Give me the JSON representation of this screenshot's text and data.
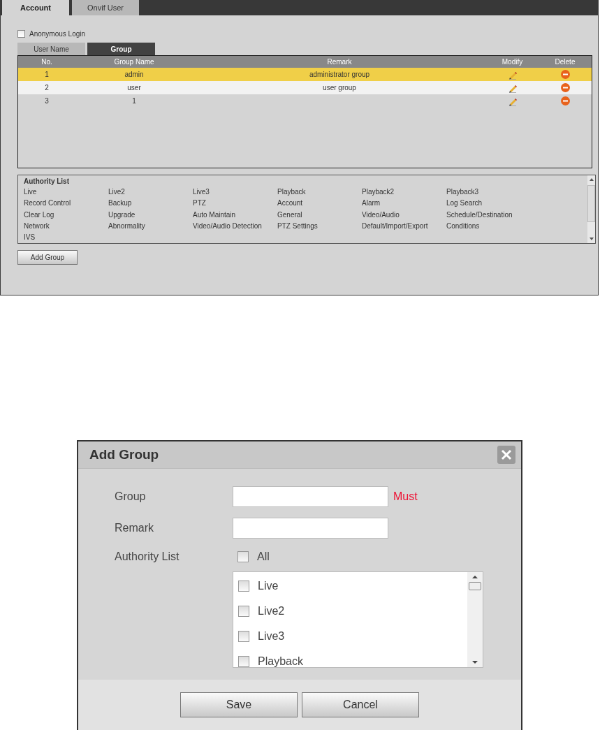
{
  "tabs": [
    {
      "label": "Account",
      "selected": true
    },
    {
      "label": "Onvif User",
      "selected": false
    }
  ],
  "anonymous_login": {
    "label": "Anonymous Login",
    "checked": false
  },
  "sub_tabs": [
    {
      "label": "User Name",
      "selected": false
    },
    {
      "label": "Group",
      "selected": true
    }
  ],
  "table": {
    "columns": [
      "No.",
      "Group Name",
      "Remark",
      "Modify",
      "Delete"
    ],
    "rows": [
      {
        "no": "1",
        "group_name": "admin",
        "remark": "administrator group",
        "selected": true
      },
      {
        "no": "2",
        "group_name": "user",
        "remark": "user group",
        "selected": false
      },
      {
        "no": "3",
        "group_name": "1",
        "remark": "",
        "selected": false
      }
    ]
  },
  "authority_list": {
    "title": "Authority List",
    "items": [
      "Live",
      "Live2",
      "Live3",
      "Playback",
      "Playback2",
      "Playback3",
      "Record Control",
      "Backup",
      "PTZ",
      "Account",
      "Alarm",
      "Log Search",
      "Clear Log",
      "Upgrade",
      "Auto Maintain",
      "General",
      "Video/Audio",
      "Schedule/Destination",
      "Network",
      "Abnormality",
      "Video/Audio Detection",
      "PTZ Settings",
      "Default/Import/Export",
      "Conditions",
      "IVS"
    ]
  },
  "add_group_button": "Add Group",
  "dialog": {
    "title": "Add Group",
    "group_label": "Group",
    "group_required": "Must",
    "remark_label": "Remark",
    "authority_label": "Authority List",
    "all": {
      "label": "All",
      "checked": false
    },
    "items": [
      {
        "label": "Live",
        "checked": false
      },
      {
        "label": "Live2",
        "checked": false
      },
      {
        "label": "Live3",
        "checked": false
      },
      {
        "label": "Playback",
        "checked": false
      }
    ],
    "buttons": [
      "Save",
      "Cancel"
    ]
  }
}
